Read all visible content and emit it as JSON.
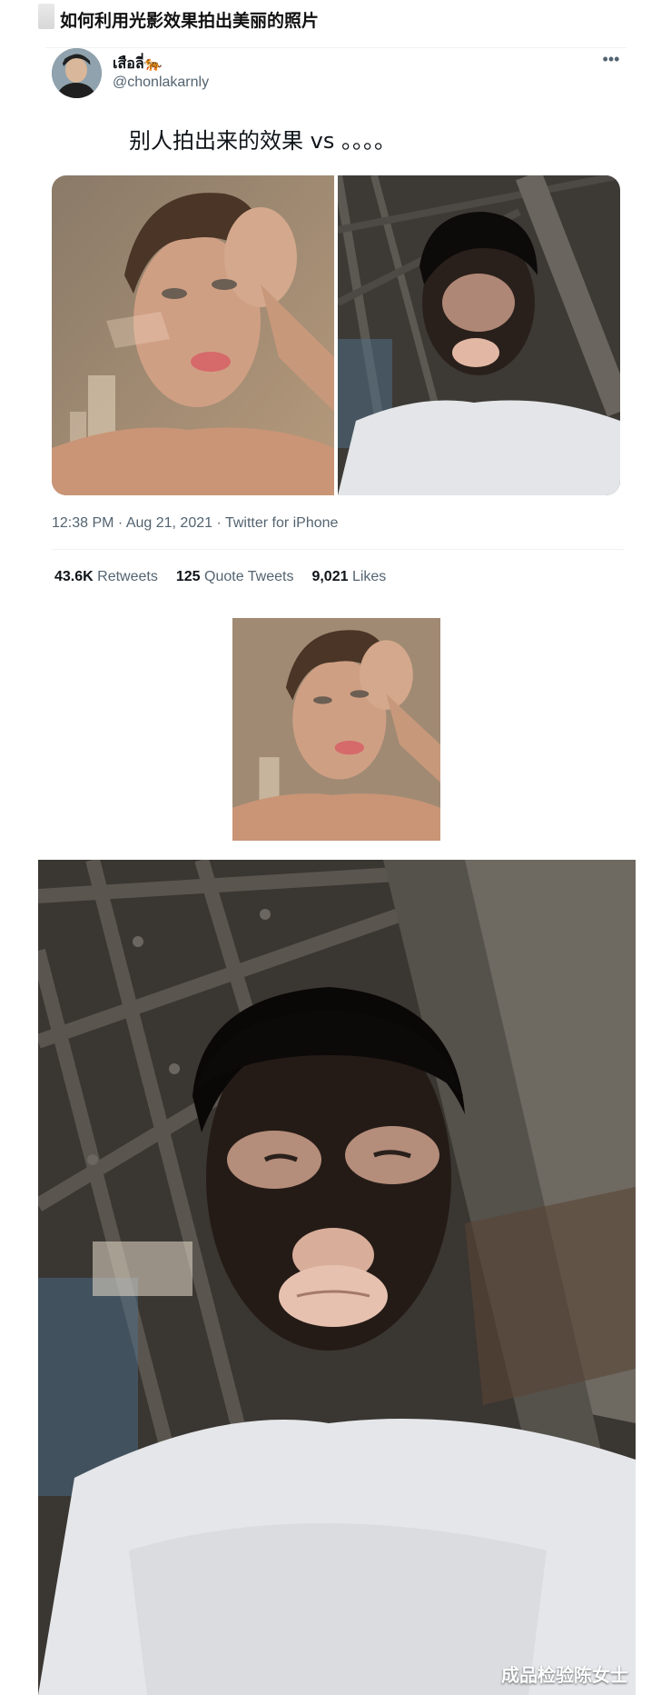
{
  "article": {
    "title": "如何利用光影效果拍出美丽的照片"
  },
  "tweet": {
    "author": {
      "display_name": "เสือลี่🐅",
      "handle": "@chonlakarnly"
    },
    "more_icon": "more-horizontal-icon",
    "text": "别人拍出来的效果 vs 。。。。",
    "meta": "12:38 PM · Aug 21, 2021 · Twitter for iPhone",
    "stats": [
      {
        "count": "43.6K",
        "label": "Retweets"
      },
      {
        "count": "125",
        "label": "Quote Tweets"
      },
      {
        "count": "9,021",
        "label": "Likes"
      }
    ]
  },
  "watermark": "成品检验陈女士",
  "colors": {
    "text_primary": "#0f1419",
    "text_secondary": "#536471",
    "divider": "#eff3f4",
    "background": "#ffffff"
  }
}
